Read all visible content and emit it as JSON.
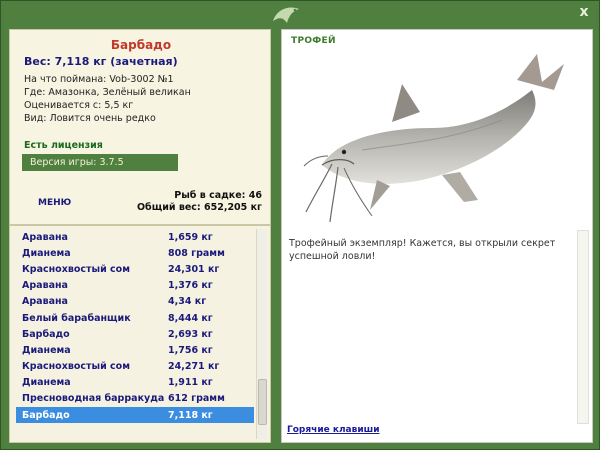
{
  "window": {
    "close_label": "x"
  },
  "info": {
    "fish_name": "Барбадо",
    "weight_line": "Вес: 7,118 кг (зачетная)",
    "lines": [
      "На что поймана: Vob-3002 №1",
      "Где: Амазонка, Зелёный великан",
      "Оценивается с: 5,5 кг",
      "Вид: Ловится очень редко"
    ],
    "license": "Есть лицензия",
    "version": "Версия игры: 3.7.5"
  },
  "menu": {
    "label": "МЕНЮ"
  },
  "keepnet": {
    "count_line": "Рыб в садке: 46",
    "total_line": "Общий вес: 652,205 кг"
  },
  "catch_list": [
    {
      "name": "Аравана",
      "weight": "1,659 кг"
    },
    {
      "name": "Дианема",
      "weight": "808 грамм"
    },
    {
      "name": "Краснохвостый сом",
      "weight": "24,301 кг"
    },
    {
      "name": "Аравана",
      "weight": "1,376 кг"
    },
    {
      "name": "Аравана",
      "weight": "4,34 кг"
    },
    {
      "name": "Белый барабанщик",
      "weight": "8,444 кг"
    },
    {
      "name": "Барбадо",
      "weight": "2,693 кг"
    },
    {
      "name": "Дианема",
      "weight": "1,756 кг"
    },
    {
      "name": "Краснохвостый сом",
      "weight": "24,271 кг"
    },
    {
      "name": "Дианема",
      "weight": "1,911 кг"
    },
    {
      "name": "Пресноводная барракуда",
      "weight": "612 грамм"
    },
    {
      "name": "Барбадо",
      "weight": "7,118 кг",
      "selected": true
    }
  ],
  "trophy": {
    "title": "ТРОФЕЙ",
    "message": "Трофейный экземпляр! Кажется, вы открыли секрет успешной ловли!",
    "hotkeys_link": "Горячие клавиши"
  },
  "colors": {
    "frame_green": "#4f8040",
    "fish_name_red": "#c0392b",
    "list_text_navy": "#1a1a7a",
    "selected_blue": "#3b8de0"
  }
}
